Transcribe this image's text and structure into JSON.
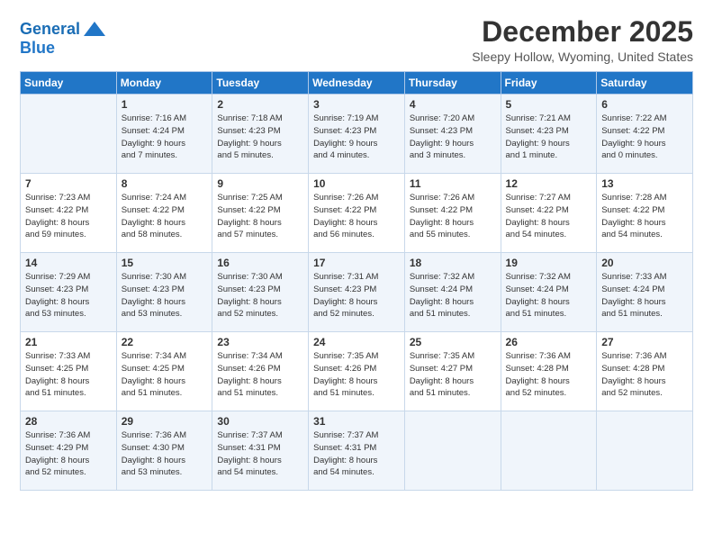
{
  "logo": {
    "line1": "General",
    "line2": "Blue"
  },
  "title": "December 2025",
  "subtitle": "Sleepy Hollow, Wyoming, United States",
  "header": {
    "days": [
      "Sunday",
      "Monday",
      "Tuesday",
      "Wednesday",
      "Thursday",
      "Friday",
      "Saturday"
    ]
  },
  "weeks": [
    [
      {
        "day": "",
        "info": ""
      },
      {
        "day": "1",
        "info": "Sunrise: 7:16 AM\nSunset: 4:24 PM\nDaylight: 9 hours\nand 7 minutes."
      },
      {
        "day": "2",
        "info": "Sunrise: 7:18 AM\nSunset: 4:23 PM\nDaylight: 9 hours\nand 5 minutes."
      },
      {
        "day": "3",
        "info": "Sunrise: 7:19 AM\nSunset: 4:23 PM\nDaylight: 9 hours\nand 4 minutes."
      },
      {
        "day": "4",
        "info": "Sunrise: 7:20 AM\nSunset: 4:23 PM\nDaylight: 9 hours\nand 3 minutes."
      },
      {
        "day": "5",
        "info": "Sunrise: 7:21 AM\nSunset: 4:23 PM\nDaylight: 9 hours\nand 1 minute."
      },
      {
        "day": "6",
        "info": "Sunrise: 7:22 AM\nSunset: 4:22 PM\nDaylight: 9 hours\nand 0 minutes."
      }
    ],
    [
      {
        "day": "7",
        "info": "Sunrise: 7:23 AM\nSunset: 4:22 PM\nDaylight: 8 hours\nand 59 minutes."
      },
      {
        "day": "8",
        "info": "Sunrise: 7:24 AM\nSunset: 4:22 PM\nDaylight: 8 hours\nand 58 minutes."
      },
      {
        "day": "9",
        "info": "Sunrise: 7:25 AM\nSunset: 4:22 PM\nDaylight: 8 hours\nand 57 minutes."
      },
      {
        "day": "10",
        "info": "Sunrise: 7:26 AM\nSunset: 4:22 PM\nDaylight: 8 hours\nand 56 minutes."
      },
      {
        "day": "11",
        "info": "Sunrise: 7:26 AM\nSunset: 4:22 PM\nDaylight: 8 hours\nand 55 minutes."
      },
      {
        "day": "12",
        "info": "Sunrise: 7:27 AM\nSunset: 4:22 PM\nDaylight: 8 hours\nand 54 minutes."
      },
      {
        "day": "13",
        "info": "Sunrise: 7:28 AM\nSunset: 4:22 PM\nDaylight: 8 hours\nand 54 minutes."
      }
    ],
    [
      {
        "day": "14",
        "info": "Sunrise: 7:29 AM\nSunset: 4:23 PM\nDaylight: 8 hours\nand 53 minutes."
      },
      {
        "day": "15",
        "info": "Sunrise: 7:30 AM\nSunset: 4:23 PM\nDaylight: 8 hours\nand 53 minutes."
      },
      {
        "day": "16",
        "info": "Sunrise: 7:30 AM\nSunset: 4:23 PM\nDaylight: 8 hours\nand 52 minutes."
      },
      {
        "day": "17",
        "info": "Sunrise: 7:31 AM\nSunset: 4:23 PM\nDaylight: 8 hours\nand 52 minutes."
      },
      {
        "day": "18",
        "info": "Sunrise: 7:32 AM\nSunset: 4:24 PM\nDaylight: 8 hours\nand 51 minutes."
      },
      {
        "day": "19",
        "info": "Sunrise: 7:32 AM\nSunset: 4:24 PM\nDaylight: 8 hours\nand 51 minutes."
      },
      {
        "day": "20",
        "info": "Sunrise: 7:33 AM\nSunset: 4:24 PM\nDaylight: 8 hours\nand 51 minutes."
      }
    ],
    [
      {
        "day": "21",
        "info": "Sunrise: 7:33 AM\nSunset: 4:25 PM\nDaylight: 8 hours\nand 51 minutes."
      },
      {
        "day": "22",
        "info": "Sunrise: 7:34 AM\nSunset: 4:25 PM\nDaylight: 8 hours\nand 51 minutes."
      },
      {
        "day": "23",
        "info": "Sunrise: 7:34 AM\nSunset: 4:26 PM\nDaylight: 8 hours\nand 51 minutes."
      },
      {
        "day": "24",
        "info": "Sunrise: 7:35 AM\nSunset: 4:26 PM\nDaylight: 8 hours\nand 51 minutes."
      },
      {
        "day": "25",
        "info": "Sunrise: 7:35 AM\nSunset: 4:27 PM\nDaylight: 8 hours\nand 51 minutes."
      },
      {
        "day": "26",
        "info": "Sunrise: 7:36 AM\nSunset: 4:28 PM\nDaylight: 8 hours\nand 52 minutes."
      },
      {
        "day": "27",
        "info": "Sunrise: 7:36 AM\nSunset: 4:28 PM\nDaylight: 8 hours\nand 52 minutes."
      }
    ],
    [
      {
        "day": "28",
        "info": "Sunrise: 7:36 AM\nSunset: 4:29 PM\nDaylight: 8 hours\nand 52 minutes."
      },
      {
        "day": "29",
        "info": "Sunrise: 7:36 AM\nSunset: 4:30 PM\nDaylight: 8 hours\nand 53 minutes."
      },
      {
        "day": "30",
        "info": "Sunrise: 7:37 AM\nSunset: 4:31 PM\nDaylight: 8 hours\nand 54 minutes."
      },
      {
        "day": "31",
        "info": "Sunrise: 7:37 AM\nSunset: 4:31 PM\nDaylight: 8 hours\nand 54 minutes."
      },
      {
        "day": "",
        "info": ""
      },
      {
        "day": "",
        "info": ""
      },
      {
        "day": "",
        "info": ""
      }
    ]
  ]
}
